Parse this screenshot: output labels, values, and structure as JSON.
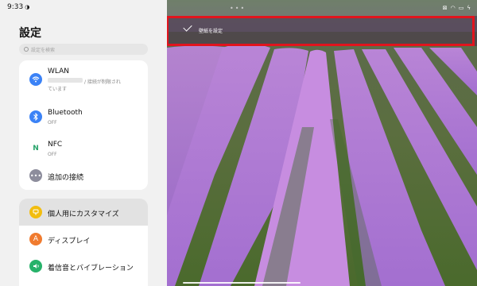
{
  "status": {
    "time": "9:33"
  },
  "settings": {
    "title": "設定",
    "search_placeholder": "設定を検索",
    "connection_items": [
      {
        "icon": "wifi-icon",
        "label": "WLAN",
        "sub_line1": "/ 接続が制限され",
        "sub_line2": "ています",
        "color": "#3b82f6"
      },
      {
        "icon": "bluetooth-icon",
        "label": "Bluetooth",
        "sub_line1": "OFF",
        "color": "#3b82f6"
      },
      {
        "icon": "nfc-icon",
        "label": "NFC",
        "sub_line1": "OFF",
        "color": "#27a36a"
      },
      {
        "icon": "more-icon",
        "label": "追加の接続",
        "color": "#8d8d9c"
      }
    ],
    "personal_items": [
      {
        "icon": "palette-icon",
        "label": "個人用にカスタマイズ",
        "color": "#f2bd0f"
      },
      {
        "icon": "display-icon",
        "label": "ディスプレイ",
        "color": "#f07b2f"
      },
      {
        "icon": "sound-icon",
        "label": "着信音とバイブレーション",
        "color": "#27b26a"
      }
    ]
  },
  "wallpaper": {
    "action_label": "壁紙を設定"
  }
}
